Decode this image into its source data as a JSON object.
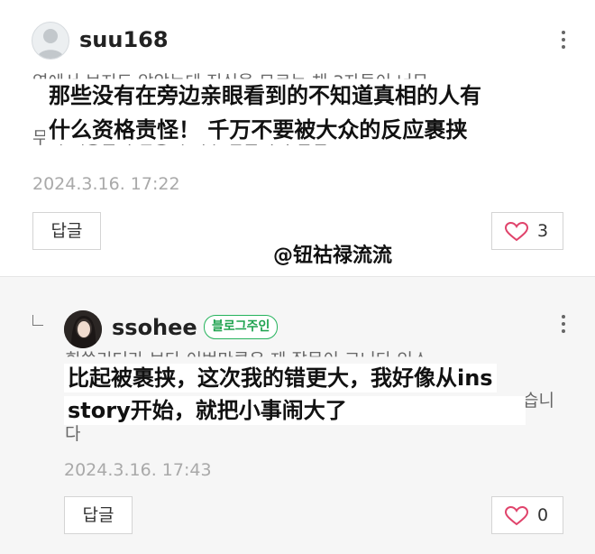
{
  "watermark": "@钮祜禄流流",
  "comments": [
    {
      "username": "suu168",
      "korean_lines": [
        "옆에서 보지도 않았는데 진심을 모르는 채 3자들이 너무",
        "르",
        "무니 대중들의 반응에 너무 휩쓸리지 말길"
      ],
      "overlay_lines": [
        "那些没有在旁边亲眼看到的不知道真相的人有",
        "什么资格责怪！  千万不要被大众的反应裹挟"
      ],
      "date": "2024.3.16. 17:22",
      "reply_label": "답글",
      "like_count": "3"
    },
    {
      "username": "ssohee",
      "badge": "블로그주인",
      "korean_lines": [
        "휘쓸리더라 보다 이번만큼은 제 잘못이 크니다 인스",
        "습니",
        "다"
      ],
      "overlay_lines": [
        "比起被裹挟，这次我的错更大，我好像从ins",
        "story开始，就把小事闹大了"
      ],
      "date": "2024.3.16. 17:43",
      "reply_label": "답글",
      "like_count": "0"
    }
  ],
  "colors": {
    "badge_green": "#25b35c",
    "heart": "#e0436b",
    "date_gray": "#a9a9a9"
  },
  "icons": [
    "default-avatar-icon",
    "more-options-icon",
    "reply-arrow-icon",
    "heart-icon"
  ]
}
